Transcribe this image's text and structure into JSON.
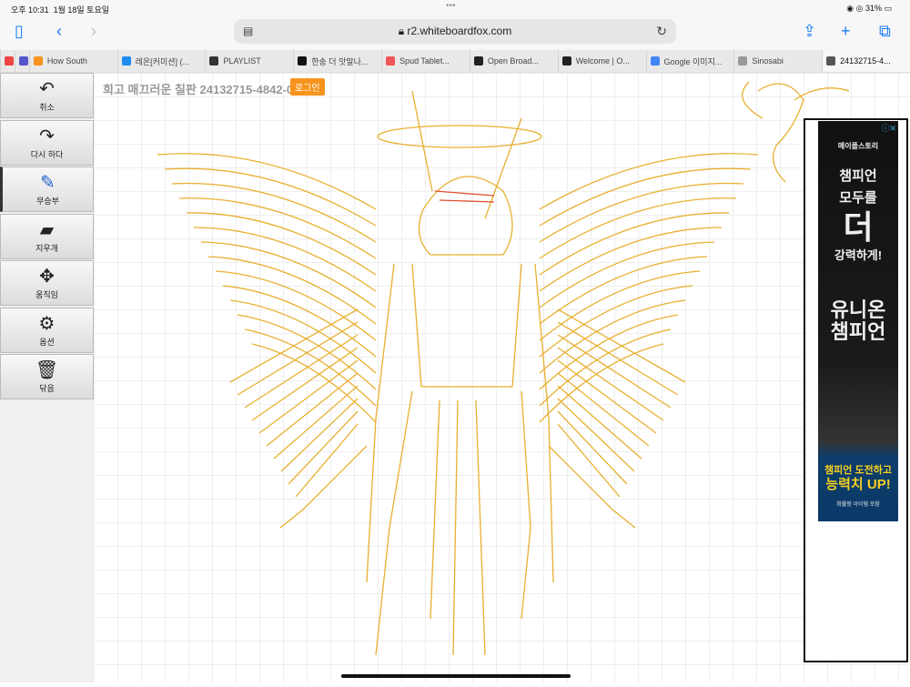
{
  "status_bar": {
    "time": "오후 10:31",
    "date": "1월 18일 토요일",
    "battery": "31%",
    "dots": "•••"
  },
  "browser": {
    "url": "r2.whiteboardfox.com",
    "tabs": [
      {
        "label": "",
        "color": "#e44"
      },
      {
        "label": "",
        "color": "#55c"
      },
      {
        "label": "How South",
        "color": "#f7941d"
      },
      {
        "label": "레온[커미션] (...",
        "color": "#1d8cf0"
      },
      {
        "label": "PLAYLIST",
        "color": "#333"
      },
      {
        "label": "한송 더 맛말나...",
        "color": "#111"
      },
      {
        "label": "Spud Tablet...",
        "color": "#e55"
      },
      {
        "label": "Open Broad...",
        "color": "#222"
      },
      {
        "label": "Welcome | O...",
        "color": "#222"
      },
      {
        "label": "Google 이미지...",
        "color": "#4285f4"
      },
      {
        "label": "Sinosabi",
        "color": "#999"
      },
      {
        "label": "24132715-4...",
        "color": "#555"
      }
    ]
  },
  "sidebar": {
    "items": [
      {
        "label": "취소",
        "icon": "undo-icon"
      },
      {
        "label": "다시 하다",
        "icon": "redo-icon"
      },
      {
        "label": "무승부",
        "icon": "pencil-icon"
      },
      {
        "label": "지우개",
        "icon": "eraser-icon"
      },
      {
        "label": "움직임",
        "icon": "move-icon"
      },
      {
        "label": "옵션",
        "icon": "gear-icon"
      },
      {
        "label": "닦음",
        "icon": "trash-icon"
      }
    ]
  },
  "board": {
    "title": "희고 매끄러운 칠판 24132715-4842-0",
    "login": "로그인",
    "stroke_color": "#e8b030"
  },
  "ad": {
    "brand": "메이플스토리",
    "line1": "챔피언",
    "line2": "모두를",
    "big": "더",
    "line3": "강력하게!",
    "line4": "유니온",
    "line5": "챔피언",
    "cta1": "챔피언 도전하고",
    "cta2": "능력치 UP!",
    "small": "확률형 아이템 포함",
    "close": "ⓘ✕"
  }
}
